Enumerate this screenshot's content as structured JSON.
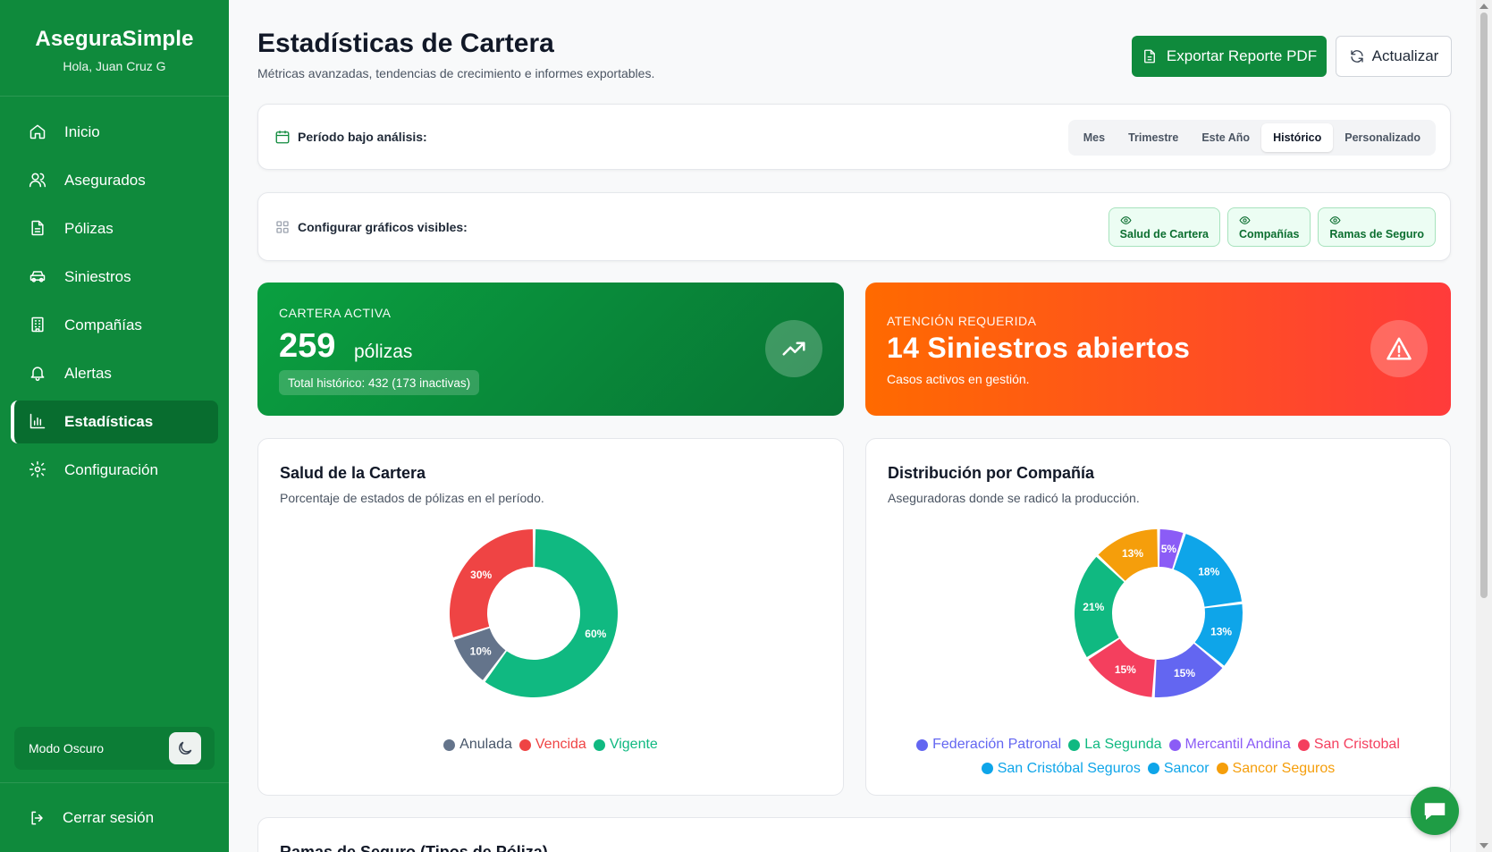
{
  "sidebar": {
    "brand": "AseguraSimple",
    "greeting": "Hola, Juan Cruz G",
    "items": [
      {
        "label": "Inicio",
        "icon": "home-icon"
      },
      {
        "label": "Asegurados",
        "icon": "users-icon"
      },
      {
        "label": "Pólizas",
        "icon": "file-icon"
      },
      {
        "label": "Siniestros",
        "icon": "car-icon"
      },
      {
        "label": "Compañías",
        "icon": "building-icon"
      },
      {
        "label": "Alertas",
        "icon": "bell-icon"
      },
      {
        "label": "Estadísticas",
        "icon": "bar-chart-icon",
        "active": true
      },
      {
        "label": "Configuración",
        "icon": "gear-icon"
      }
    ],
    "dark_mode_label": "Modo Oscuro",
    "logout_label": "Cerrar sesión"
  },
  "header": {
    "title": "Estadísticas de Cartera",
    "subtitle": "Métricas avanzadas, tendencias de crecimiento e informes exportables.",
    "export_label": "Exportar Reporte PDF",
    "refresh_label": "Actualizar"
  },
  "period": {
    "label": "Período bajo análisis:",
    "options": [
      "Mes",
      "Trimestre",
      "Este Año",
      "Histórico",
      "Personalizado"
    ],
    "selected": "Histórico"
  },
  "config": {
    "label": "Configurar gráficos visibles:",
    "toggles": [
      "Salud de Cartera",
      "Compañías",
      "Ramas de Seguro"
    ]
  },
  "kpi_active": {
    "label": "CARTERA ACTIVA",
    "value": "259",
    "unit": "pólizas",
    "chip": "Total histórico: 432 (173 inactivas)"
  },
  "kpi_attention": {
    "label": "ATENCIÓN REQUERIDA",
    "title": "14 Siniestros abiertos",
    "desc": "Casos activos en gestión."
  },
  "health_card": {
    "title": "Salud de la Cartera",
    "subtitle": "Porcentaje de estados de pólizas en el período."
  },
  "company_card": {
    "title": "Distribución por Compañía",
    "subtitle": "Aseguradoras donde se radicó la producción."
  },
  "bottom_card": {
    "title": "Ramas de Seguro (Tipos de Póliza)"
  },
  "colors": {
    "primary": "#0f8a3c",
    "anulada": "#64748b",
    "vencida": "#ef4444",
    "vigente": "#10b981"
  },
  "chart_data": [
    {
      "type": "pie",
      "variant": "donut",
      "categories": [
        "Anulada",
        "Vencida",
        "Vigente"
      ],
      "values": [
        10,
        30,
        60
      ],
      "value_labels": [
        "10%",
        "30%",
        "60%"
      ],
      "colors": [
        "#64748b",
        "#ef4444",
        "#10b981"
      ],
      "legend": "bottom"
    },
    {
      "type": "pie",
      "variant": "donut",
      "categories": [
        "Federación Patronal",
        "La Segunda",
        "Mercantil Andina",
        "San Cristobal",
        "San Cristóbal Seguros",
        "Sancor",
        "Sancor Seguros"
      ],
      "values": [
        15,
        21,
        5,
        15,
        18,
        13,
        13
      ],
      "value_labels": [
        "15%",
        "21%",
        "5%",
        "15%",
        "18%",
        "13%",
        "13%"
      ],
      "colors": [
        "#6366f1",
        "#10b981",
        "#8b5cf6",
        "#f43f5e",
        "#0ea5e9",
        "#0ea5e9",
        "#f59e0b"
      ],
      "legend": "bottom"
    }
  ]
}
